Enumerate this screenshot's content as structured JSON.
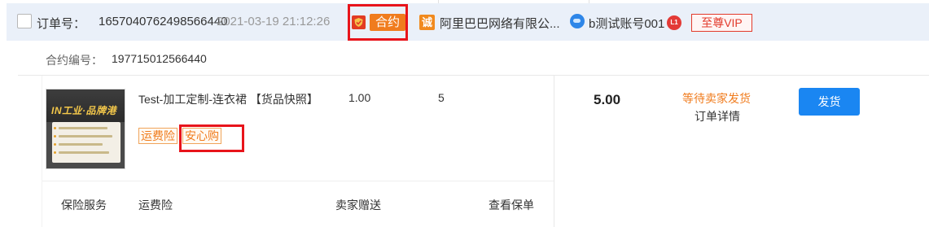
{
  "header": {
    "order_label": "订单号：",
    "order_number": "1657040762498566440",
    "order_time": "2021-03-19 21:12:26",
    "contract_tag": "合约",
    "company": "阿里巴巴网络有限公...",
    "cheng_badge": "诚",
    "buyer": "b测试账号001",
    "level_badge": "L1",
    "vip_label": "至尊VIP"
  },
  "contract": {
    "label": "合约编号：",
    "number": "197715012566440"
  },
  "product": {
    "thumb_logo": "IN工业·品牌港",
    "title": "Test-加工定制-连衣裙 【货品快照】",
    "tags": [
      "运费险",
      "安心购"
    ],
    "unit_price": "1.00",
    "quantity": "5"
  },
  "summary": {
    "total": "5.00",
    "status": "等待卖家发货",
    "detail_link": "订单详情",
    "ship_button": "发货"
  },
  "service": {
    "label": "保险服务",
    "item": "运费险",
    "gift": "卖家赠送",
    "link": "查看保单"
  },
  "colors": {
    "header_bg": "#eaf0f9",
    "accent_orange": "#f07c1e",
    "primary_blue": "#1a86f2",
    "highlight_red": "#e8141b",
    "vip_red": "#e23a2b"
  },
  "icons": [
    "shield-icon",
    "cheng-icon",
    "wangwang-icon",
    "level-icon"
  ]
}
